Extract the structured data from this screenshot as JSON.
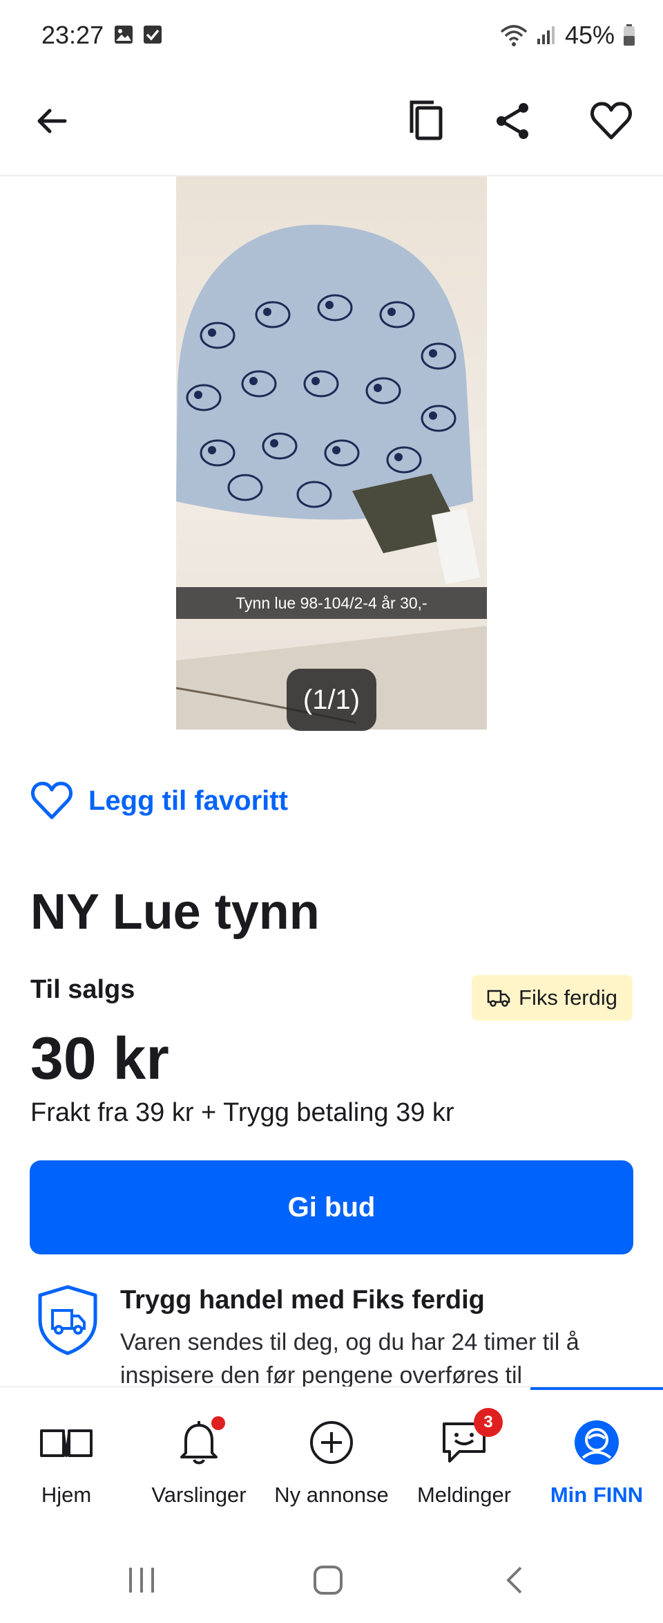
{
  "status_bar": {
    "time": "23:27",
    "battery": "45%"
  },
  "gallery": {
    "caption": "Tynn lue 98-104/2-4 år 30,-",
    "counter": "(1/1)"
  },
  "favorite": {
    "label": "Legg til favoritt"
  },
  "listing": {
    "title": "NY Lue tynn",
    "status": "Til salgs",
    "badge": "Fiks ferdig",
    "price": "30 kr",
    "shipping": "Frakt fra 39 kr + Trygg betaling 39 kr"
  },
  "bid_button": {
    "label": "Gi bud"
  },
  "safe_trade": {
    "title": "Trygg handel med Fiks ferdig",
    "text": "Varen sendes til deg, og du har 24 timer til å inspisere den før pengene overføres til"
  },
  "bottom_nav": {
    "items": [
      {
        "label": "Hjem",
        "icon": "book-icon"
      },
      {
        "label": "Varslinger",
        "icon": "bell-icon"
      },
      {
        "label": "Ny annonse",
        "icon": "plus-circle-icon"
      },
      {
        "label": "Meldinger",
        "icon": "message-icon",
        "badge": "3"
      },
      {
        "label": "Min FINN",
        "icon": "profile-icon"
      }
    ]
  },
  "colors": {
    "accent": "#0063fb",
    "badge_bg": "#fff5c8",
    "notification": "#e02020"
  }
}
